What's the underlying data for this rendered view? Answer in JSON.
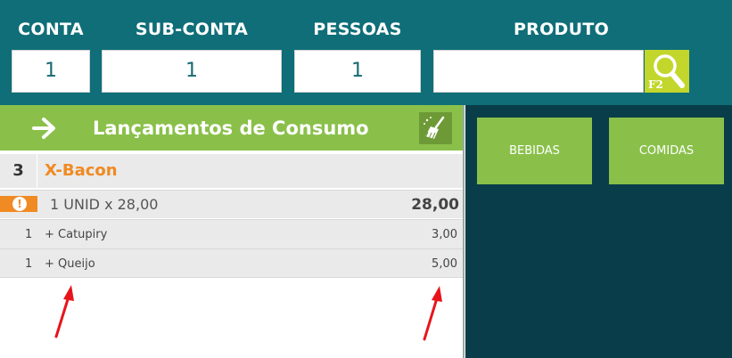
{
  "header": {
    "conta": {
      "label": "CONTA",
      "value": "1"
    },
    "sub_conta": {
      "label": "SUB-CONTA",
      "value": "1"
    },
    "pessoas": {
      "label": "PESSOAS",
      "value": "1"
    },
    "produto": {
      "label": "PRODUTO",
      "value": "",
      "search_shortcut": "F2"
    }
  },
  "consumo": {
    "title": "Lançamentos de Consumo",
    "item": {
      "qty": "3",
      "name": "X-Bacon",
      "unit_line": "1 UNID x 28,00",
      "total": "28,00",
      "warning_symbol": "!"
    },
    "additions": [
      {
        "qty": "1",
        "name": "+ Catupiry",
        "price": "3,00"
      },
      {
        "qty": "1",
        "name": "+ Queijo",
        "price": "5,00"
      }
    ]
  },
  "categories": [
    {
      "label": "BEBIDAS"
    },
    {
      "label": "COMIDAS"
    }
  ],
  "colors": {
    "header_bg": "#0f6e78",
    "title_bar": "#8ac04a",
    "item_name": "#f08a22",
    "right_panel": "#093d49",
    "annotation_arrow": "#e8141c"
  }
}
